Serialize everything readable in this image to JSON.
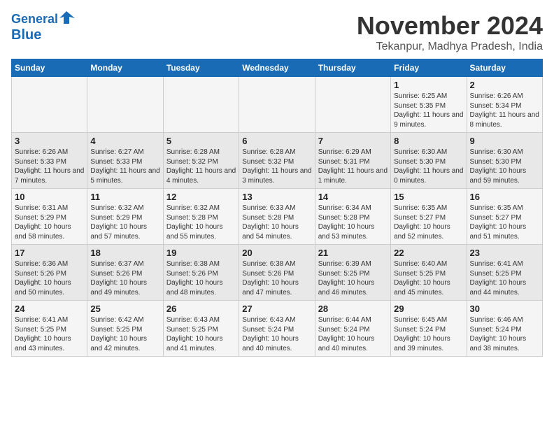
{
  "header": {
    "logo_line1": "General",
    "logo_line2": "Blue",
    "month": "November 2024",
    "location": "Tekanpur, Madhya Pradesh, India"
  },
  "weekdays": [
    "Sunday",
    "Monday",
    "Tuesday",
    "Wednesday",
    "Thursday",
    "Friday",
    "Saturday"
  ],
  "weeks": [
    [
      {
        "day": "",
        "info": ""
      },
      {
        "day": "",
        "info": ""
      },
      {
        "day": "",
        "info": ""
      },
      {
        "day": "",
        "info": ""
      },
      {
        "day": "",
        "info": ""
      },
      {
        "day": "1",
        "info": "Sunrise: 6:25 AM\nSunset: 5:35 PM\nDaylight: 11 hours and 9 minutes."
      },
      {
        "day": "2",
        "info": "Sunrise: 6:26 AM\nSunset: 5:34 PM\nDaylight: 11 hours and 8 minutes."
      }
    ],
    [
      {
        "day": "3",
        "info": "Sunrise: 6:26 AM\nSunset: 5:33 PM\nDaylight: 11 hours and 7 minutes."
      },
      {
        "day": "4",
        "info": "Sunrise: 6:27 AM\nSunset: 5:33 PM\nDaylight: 11 hours and 5 minutes."
      },
      {
        "day": "5",
        "info": "Sunrise: 6:28 AM\nSunset: 5:32 PM\nDaylight: 11 hours and 4 minutes."
      },
      {
        "day": "6",
        "info": "Sunrise: 6:28 AM\nSunset: 5:32 PM\nDaylight: 11 hours and 3 minutes."
      },
      {
        "day": "7",
        "info": "Sunrise: 6:29 AM\nSunset: 5:31 PM\nDaylight: 11 hours and 1 minute."
      },
      {
        "day": "8",
        "info": "Sunrise: 6:30 AM\nSunset: 5:30 PM\nDaylight: 11 hours and 0 minutes."
      },
      {
        "day": "9",
        "info": "Sunrise: 6:30 AM\nSunset: 5:30 PM\nDaylight: 10 hours and 59 minutes."
      }
    ],
    [
      {
        "day": "10",
        "info": "Sunrise: 6:31 AM\nSunset: 5:29 PM\nDaylight: 10 hours and 58 minutes."
      },
      {
        "day": "11",
        "info": "Sunrise: 6:32 AM\nSunset: 5:29 PM\nDaylight: 10 hours and 57 minutes."
      },
      {
        "day": "12",
        "info": "Sunrise: 6:32 AM\nSunset: 5:28 PM\nDaylight: 10 hours and 55 minutes."
      },
      {
        "day": "13",
        "info": "Sunrise: 6:33 AM\nSunset: 5:28 PM\nDaylight: 10 hours and 54 minutes."
      },
      {
        "day": "14",
        "info": "Sunrise: 6:34 AM\nSunset: 5:28 PM\nDaylight: 10 hours and 53 minutes."
      },
      {
        "day": "15",
        "info": "Sunrise: 6:35 AM\nSunset: 5:27 PM\nDaylight: 10 hours and 52 minutes."
      },
      {
        "day": "16",
        "info": "Sunrise: 6:35 AM\nSunset: 5:27 PM\nDaylight: 10 hours and 51 minutes."
      }
    ],
    [
      {
        "day": "17",
        "info": "Sunrise: 6:36 AM\nSunset: 5:26 PM\nDaylight: 10 hours and 50 minutes."
      },
      {
        "day": "18",
        "info": "Sunrise: 6:37 AM\nSunset: 5:26 PM\nDaylight: 10 hours and 49 minutes."
      },
      {
        "day": "19",
        "info": "Sunrise: 6:38 AM\nSunset: 5:26 PM\nDaylight: 10 hours and 48 minutes."
      },
      {
        "day": "20",
        "info": "Sunrise: 6:38 AM\nSunset: 5:26 PM\nDaylight: 10 hours and 47 minutes."
      },
      {
        "day": "21",
        "info": "Sunrise: 6:39 AM\nSunset: 5:25 PM\nDaylight: 10 hours and 46 minutes."
      },
      {
        "day": "22",
        "info": "Sunrise: 6:40 AM\nSunset: 5:25 PM\nDaylight: 10 hours and 45 minutes."
      },
      {
        "day": "23",
        "info": "Sunrise: 6:41 AM\nSunset: 5:25 PM\nDaylight: 10 hours and 44 minutes."
      }
    ],
    [
      {
        "day": "24",
        "info": "Sunrise: 6:41 AM\nSunset: 5:25 PM\nDaylight: 10 hours and 43 minutes."
      },
      {
        "day": "25",
        "info": "Sunrise: 6:42 AM\nSunset: 5:25 PM\nDaylight: 10 hours and 42 minutes."
      },
      {
        "day": "26",
        "info": "Sunrise: 6:43 AM\nSunset: 5:25 PM\nDaylight: 10 hours and 41 minutes."
      },
      {
        "day": "27",
        "info": "Sunrise: 6:43 AM\nSunset: 5:24 PM\nDaylight: 10 hours and 40 minutes."
      },
      {
        "day": "28",
        "info": "Sunrise: 6:44 AM\nSunset: 5:24 PM\nDaylight: 10 hours and 40 minutes."
      },
      {
        "day": "29",
        "info": "Sunrise: 6:45 AM\nSunset: 5:24 PM\nDaylight: 10 hours and 39 minutes."
      },
      {
        "day": "30",
        "info": "Sunrise: 6:46 AM\nSunset: 5:24 PM\nDaylight: 10 hours and 38 minutes."
      }
    ]
  ]
}
